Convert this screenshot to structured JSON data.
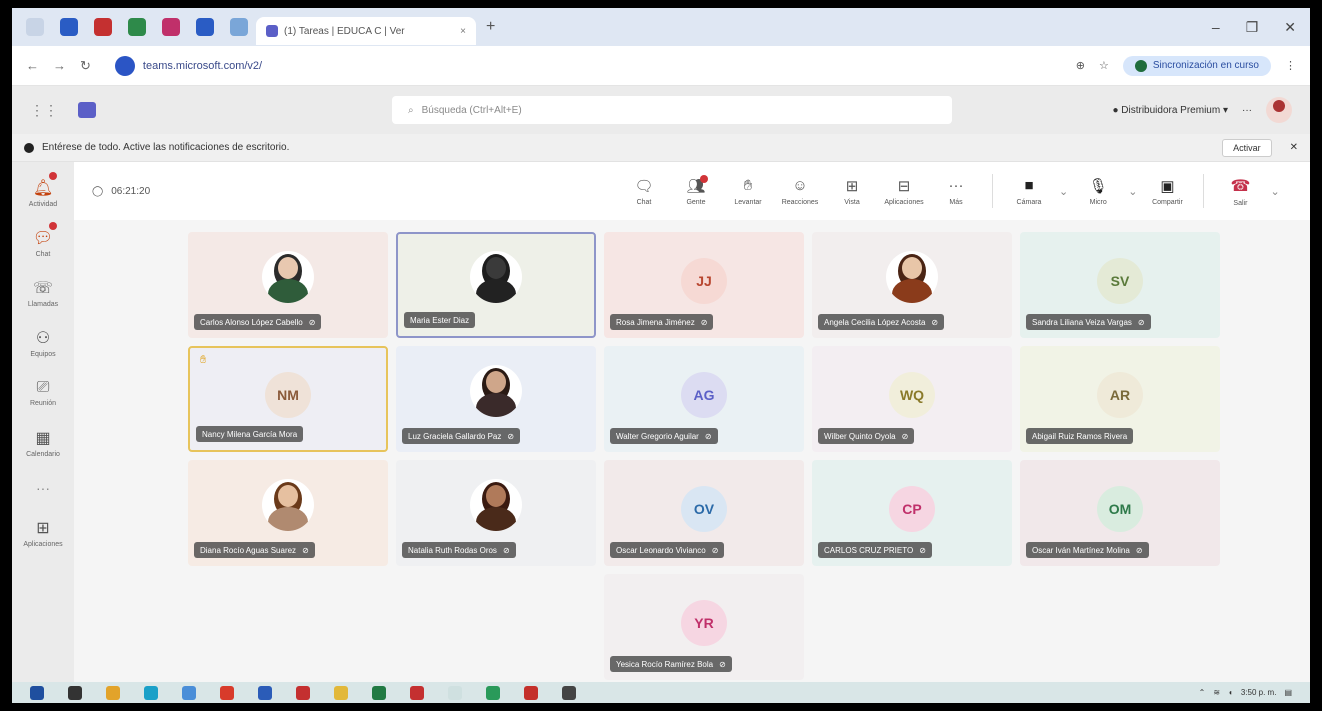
{
  "browser": {
    "tab_title": "(1) Tareas | EDUCA C | Ver",
    "url": "teams.microsoft.com/v2/",
    "profile_label": "Sincronización en curso"
  },
  "teams": {
    "search_placeholder": "Búsqueda (Ctrl+Alt+E)",
    "org_label": "Distribuidora Premium"
  },
  "banner": {
    "text": "Entérese de todo. Active las notificaciones de escritorio.",
    "action": "Activar"
  },
  "rail": [
    {
      "label": "Actividad",
      "icon": "bell-icon",
      "badge": true
    },
    {
      "label": "Chat",
      "icon": "chat-icon",
      "badge": true
    },
    {
      "label": "Llamadas",
      "icon": "phone-icon",
      "badge": false
    },
    {
      "label": "Equipos",
      "icon": "teams-icon",
      "badge": false
    },
    {
      "label": "Reunión",
      "icon": "camera-icon",
      "badge": false
    },
    {
      "label": "Calendario",
      "icon": "calendar-icon",
      "badge": false
    },
    {
      "label": "Aplicaciones",
      "icon": "apps-icon",
      "badge": false
    }
  ],
  "meeting": {
    "timer": "06:21:20",
    "tools": [
      {
        "label": "Chat",
        "badge": false
      },
      {
        "label": "Gente",
        "badge": true
      },
      {
        "label": "Levantar",
        "badge": false
      },
      {
        "label": "Reacciones",
        "badge": false
      },
      {
        "label": "Vista",
        "badge": false
      },
      {
        "label": "Aplicaciones",
        "badge": false
      },
      {
        "label": "Más",
        "badge": false
      }
    ],
    "media": [
      {
        "label": "Cámara"
      },
      {
        "label": "Micro"
      },
      {
        "label": "Compartir"
      }
    ],
    "leave_label": "Salir"
  },
  "participants": [
    {
      "name": "Carlos Alonso López Cabello",
      "kind": "photo",
      "skin": "#e8c8b0",
      "hair": "#2b2b2b",
      "shirt": "#2f5c3a",
      "bg": "#f4e9e6",
      "muted": true
    },
    {
      "name": "Maria Ester Diaz",
      "kind": "photo",
      "skin": "#3a3a3a",
      "hair": "#1d1d1d",
      "shirt": "#222222",
      "bg": "#eef0e8",
      "muted": false,
      "selected": "blue"
    },
    {
      "name": "Rosa Jimena Jiménez",
      "kind": "initials",
      "initials": "JJ",
      "fg": "#b8462f",
      "circle": "#f6d9d4",
      "bg": "#f6e6e4",
      "muted": true
    },
    {
      "name": "Angela Cecilia López Acosta",
      "kind": "photo",
      "skin": "#e8c6a8",
      "hair": "#4a2414",
      "shirt": "#8a3b1b",
      "bg": "#f2eeee",
      "muted": true
    },
    {
      "name": "Sandra Liliana Veiza Vargas",
      "kind": "initials",
      "initials": "SV",
      "fg": "#5a7a3a",
      "circle": "#e4ead6",
      "bg": "#e6f1ee",
      "muted": true
    },
    {
      "name": "Nancy Milena García Mora",
      "kind": "initials",
      "initials": "NM",
      "fg": "#8a5a3a",
      "circle": "#efe2d8",
      "bg": "#eeeef4",
      "muted": false,
      "selected": "yellow",
      "hand": true
    },
    {
      "name": "Luz Graciela Gallardo Paz",
      "kind": "photo",
      "skin": "#cfa68a",
      "hair": "#2a1a14",
      "shirt": "#3a2a2a",
      "bg": "#eaeef6",
      "muted": true
    },
    {
      "name": "Walter Gregorio Aguilar",
      "kind": "initials",
      "initials": "AG",
      "fg": "#5b5fc7",
      "circle": "#dcdcf2",
      "bg": "#eaf1f4",
      "muted": true
    },
    {
      "name": "Wilber Quinto Oyola",
      "kind": "initials",
      "initials": "WQ",
      "fg": "#8a7a2a",
      "circle": "#f1eedb",
      "bg": "#f3eef2",
      "muted": true
    },
    {
      "name": "Abigail Ruiz Ramos Rivera",
      "kind": "initials",
      "initials": "AR",
      "fg": "#7a6a3a",
      "circle": "#efead9",
      "bg": "#f1f3e6",
      "muted": false
    },
    {
      "name": "Diana Rocío Aguas Suarez",
      "kind": "photo",
      "skin": "#e6c0a0",
      "hair": "#6a3a1a",
      "shirt": "#b08a70",
      "bg": "#f6ebe4",
      "muted": true
    },
    {
      "name": "Natalia Ruth Rodas Oros",
      "kind": "photo",
      "skin": "#b07a5a",
      "hair": "#3a1a10",
      "shirt": "#4a2a1a",
      "bg": "#eff0f2",
      "muted": true
    },
    {
      "name": "Oscar Leonardo Vivianco",
      "kind": "initials",
      "initials": "OV",
      "fg": "#2b6aa8",
      "circle": "#d9e6f3",
      "bg": "#f2eaea",
      "muted": true
    },
    {
      "name": "CARLOS CRUZ PRIETO",
      "kind": "initials",
      "initials": "CP",
      "fg": "#c0306a",
      "circle": "#f6d6e2",
      "bg": "#e6f1ef",
      "muted": true
    },
    {
      "name": "Oscar Iván Martínez Molina",
      "kind": "initials",
      "initials": "OM",
      "fg": "#2e7a4a",
      "circle": "#d9ecdf",
      "bg": "#f1e8ea",
      "muted": true
    },
    {
      "name": "Yesica Rocío Ramírez Bola",
      "kind": "initials",
      "initials": "YR",
      "fg": "#c0306a",
      "circle": "#f6d6e2",
      "bg": "#f2eff0",
      "muted": true
    }
  ],
  "taskbar": {
    "time": "3:50 p. m."
  }
}
